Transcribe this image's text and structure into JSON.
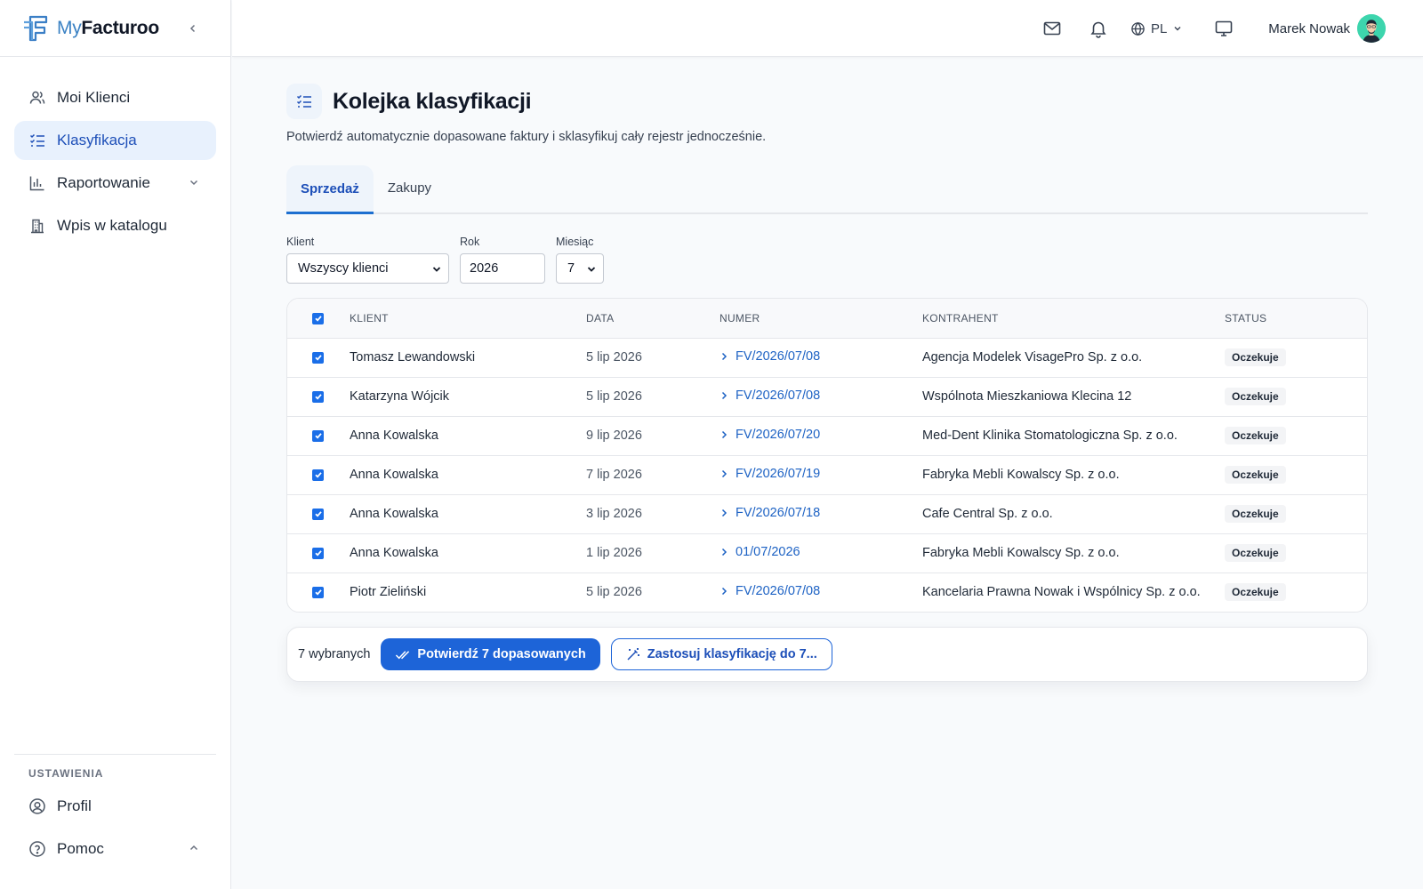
{
  "brand": {
    "name_light": "My",
    "name_bold": "Facturoo"
  },
  "sidebar": {
    "items": [
      {
        "label": "Moi Klienci",
        "icon": "users-icon"
      },
      {
        "label": "Klasyfikacja",
        "icon": "list-check-icon",
        "active": true
      },
      {
        "label": "Raportowanie",
        "icon": "bar-chart-icon"
      },
      {
        "label": "Wpis w katalogu",
        "icon": "building-icon"
      }
    ],
    "settings_title": "USTAWIENIA",
    "settings_items": [
      {
        "label": "Profil",
        "icon": "user-circle-icon"
      },
      {
        "label": "Pomoc",
        "icon": "help-circle-icon"
      }
    ]
  },
  "topbar": {
    "lang": "PL",
    "user_name": "Marek Nowak"
  },
  "page": {
    "title": "Kolejka klasyfikacji",
    "subtitle": "Potwierdź automatycznie dopasowane faktury i sklasyfikuj cały rejestr jednocześnie."
  },
  "tabs": [
    {
      "label": "Sprzedaż",
      "active": true
    },
    {
      "label": "Zakupy"
    }
  ],
  "filters": {
    "client_label": "Klient",
    "client_value": "Wszyscy klienci",
    "year_label": "Rok",
    "year_value": "2026",
    "month_label": "Miesiąc",
    "month_value": "7"
  },
  "table": {
    "headers": [
      "KLIENT",
      "DATA",
      "NUMER",
      "KONTRAHENT",
      "STATUS"
    ],
    "rows": [
      {
        "klient": "Tomasz Lewandowski",
        "data": "5 lip 2026",
        "numer": "FV/2026/07/08",
        "kontrahent": "Agencja Modelek VisagePro Sp. z o.o.",
        "status": "Oczekuje"
      },
      {
        "klient": "Katarzyna Wójcik",
        "data": "5 lip 2026",
        "numer": "FV/2026/07/08",
        "kontrahent": "Wspólnota Mieszkaniowa Klecina 12",
        "status": "Oczekuje"
      },
      {
        "klient": "Anna Kowalska",
        "data": "9 lip 2026",
        "numer": "FV/2026/07/20",
        "kontrahent": "Med-Dent Klinika Stomatologiczna Sp. z o.o.",
        "status": "Oczekuje"
      },
      {
        "klient": "Anna Kowalska",
        "data": "7 lip 2026",
        "numer": "FV/2026/07/19",
        "kontrahent": "Fabryka Mebli Kowalscy Sp. z o.o.",
        "status": "Oczekuje"
      },
      {
        "klient": "Anna Kowalska",
        "data": "3 lip 2026",
        "numer": "FV/2026/07/18",
        "kontrahent": "Cafe Central Sp. z o.o.",
        "status": "Oczekuje"
      },
      {
        "klient": "Anna Kowalska",
        "data": "1 lip 2026",
        "numer": "01/07/2026",
        "kontrahent": "Fabryka Mebli Kowalscy Sp. z o.o.",
        "status": "Oczekuje"
      },
      {
        "klient": "Piotr Zieliński",
        "data": "5 lip 2026",
        "numer": "FV/2026/07/08",
        "kontrahent": "Kancelaria Prawna Nowak i Wspólnicy Sp. z o.o.",
        "status": "Oczekuje"
      }
    ]
  },
  "actions": {
    "selected": "7 wybranych",
    "confirm": "Potwierdź 7 dopasowanych",
    "apply": "Zastosuj klasyfikację do 7..."
  },
  "colors": {
    "accent": "#1d64d8",
    "active_bg": "#e8f1fd",
    "link": "#1d62c4"
  }
}
